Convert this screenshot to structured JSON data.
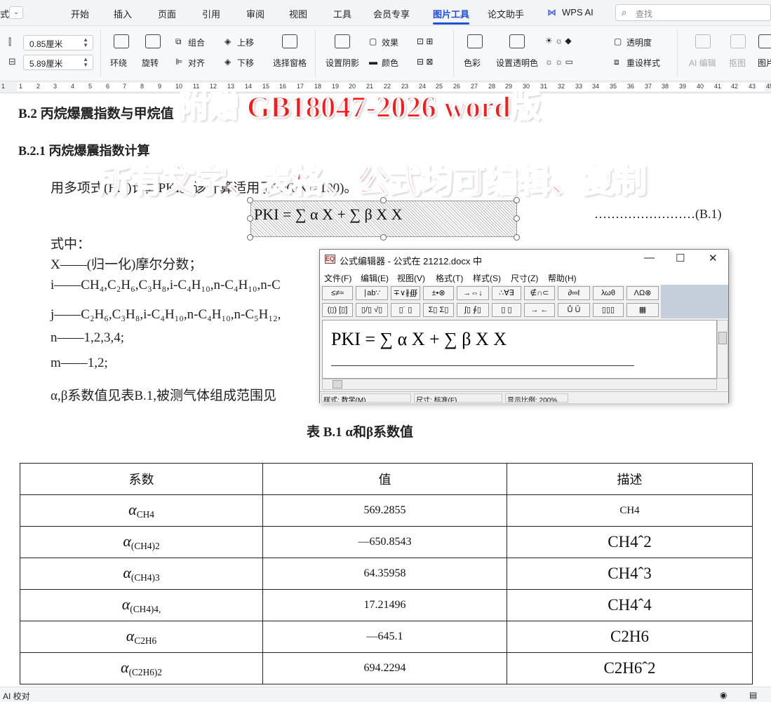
{
  "tabs": {
    "left_cut": "式",
    "items": [
      "开始",
      "插入",
      "页面",
      "引用",
      "审阅",
      "视图",
      "工具",
      "会员专享",
      "图片工具",
      "论文助手",
      "WPS AI"
    ],
    "active": "图片工具",
    "search_placeholder": "查找"
  },
  "ribbon": {
    "height_value": "0.85厘米",
    "width_value": "5.89厘米",
    "wrap": "环绕",
    "rotate": "旋转",
    "group": "组合",
    "align": "对齐",
    "bring_up": "上移",
    "send_down": "下移",
    "selection_pane": "选择窗格",
    "shadow": "设置阴影",
    "effects": "效果",
    "color": "颜色",
    "color_mode": "色彩",
    "set_transparent": "设置透明色",
    "transparency": "透明度",
    "reset_style": "重设样式",
    "ai_edit": "AI 编辑",
    "matting": "抠图",
    "more": "图片"
  },
  "ruler": {
    "numbers": [
      "1",
      "1",
      "2",
      "3",
      "4",
      "5",
      "6",
      "7",
      "8",
      "9",
      "10",
      "11",
      "12",
      "13",
      "14",
      "15",
      "16",
      "17",
      "18",
      "19",
      "20",
      "21",
      "22",
      "23",
      "24",
      "25",
      "26",
      "27",
      "28",
      "29",
      "30",
      "31",
      "32",
      "33",
      "34",
      "35",
      "36",
      "37",
      "38",
      "39",
      "40",
      "41",
      "42",
      "43",
      "45"
    ]
  },
  "doc": {
    "heading_b2": "B.2  丙烷爆震指数与甲烷值",
    "heading_b21": "B.2.1  丙烷爆震指数计算",
    "intro": "用多项式(B.1)计算PKI。该计算适用于20(PKI≥100)。",
    "formula_text": "PKI = ∑ α X + ∑ β X X",
    "formula_number": "……………………(B.1)",
    "where": "式中：",
    "def_x": "X——(归一化)摩尔分数；",
    "def_i": "i——CH₄,C₂H₆,C₃H₈,i-C₄H₁₀,n-C₄H₁₀,n-C",
    "def_j": "j——C₂H₆,C₃H₈,i-C₄H₁₀,n-C₄H₁₀,n-C₅H₁₂,",
    "def_n": "n——1,2,3,4;",
    "def_m": "m——1,2;",
    "def_ab": "α,β系数值见表B.1,被测气体组成范围见",
    "table_caption": "表 B.1  α和β系数值",
    "table": {
      "headers": [
        "系数",
        "值",
        "描述"
      ],
      "rows": [
        {
          "coef": "α",
          "sub": "CH4",
          "value": "569.2855",
          "desc": "CH4"
        },
        {
          "coef": "α",
          "sub": "(CH4)2",
          "value": "—650.8543",
          "desc": "CH4ˆ2"
        },
        {
          "coef": "α",
          "sub": "(CH4)3",
          "value": "64.35958",
          "desc": "CH4ˆ3"
        },
        {
          "coef": "α",
          "sub": "(CH4)4,",
          "value": "17.21496",
          "desc": "CH4ˆ4"
        },
        {
          "coef": "α",
          "sub": "C2H6",
          "value": "—645.1",
          "desc": "C2H6"
        },
        {
          "coef": "α",
          "sub": "(C2H6)2",
          "value": "694.2294",
          "desc": "C2H6ˆ2"
        }
      ]
    }
  },
  "banners": {
    "line1": "附赠 GB18047-2026 word版",
    "line2": "所有文字、表格、公式均可编辑、复制"
  },
  "editor": {
    "title": "公式编辑器 - 公式在 21212.docx 中",
    "app_icon": "EQ",
    "menu": [
      "文件(F)",
      "编辑(E)",
      "视图(V)",
      "格式(T)",
      "样式(S)",
      "尺寸(Z)",
      "帮助(H)"
    ],
    "palette_row1": [
      "≤≠≈",
      "∣ab∵",
      "∓∨∦∰",
      "±•⊗",
      "→⇔↓",
      "∴∀∃",
      "∉∩⊂",
      "∂∞ℓ",
      "λωθ",
      "ΛΩ⊗"
    ],
    "palette_row2": [
      "(▯) [▯]",
      "▯/▯ √▯",
      "▯˙ ▯",
      "Σ▯ Σ▯",
      "∫▯ ∮▯",
      "▯ ▯",
      "→ ←",
      "Ů Ǔ",
      "▯▯▯",
      "▦"
    ],
    "formula": "PKI = ∑ α X + ∑ β X X",
    "status_style": "样式: 数学(M)",
    "status_size": "尺寸: 标准(F)",
    "status_zoom": "显示比例: 200%"
  },
  "statusbar": {
    "left": "AI 校对"
  }
}
